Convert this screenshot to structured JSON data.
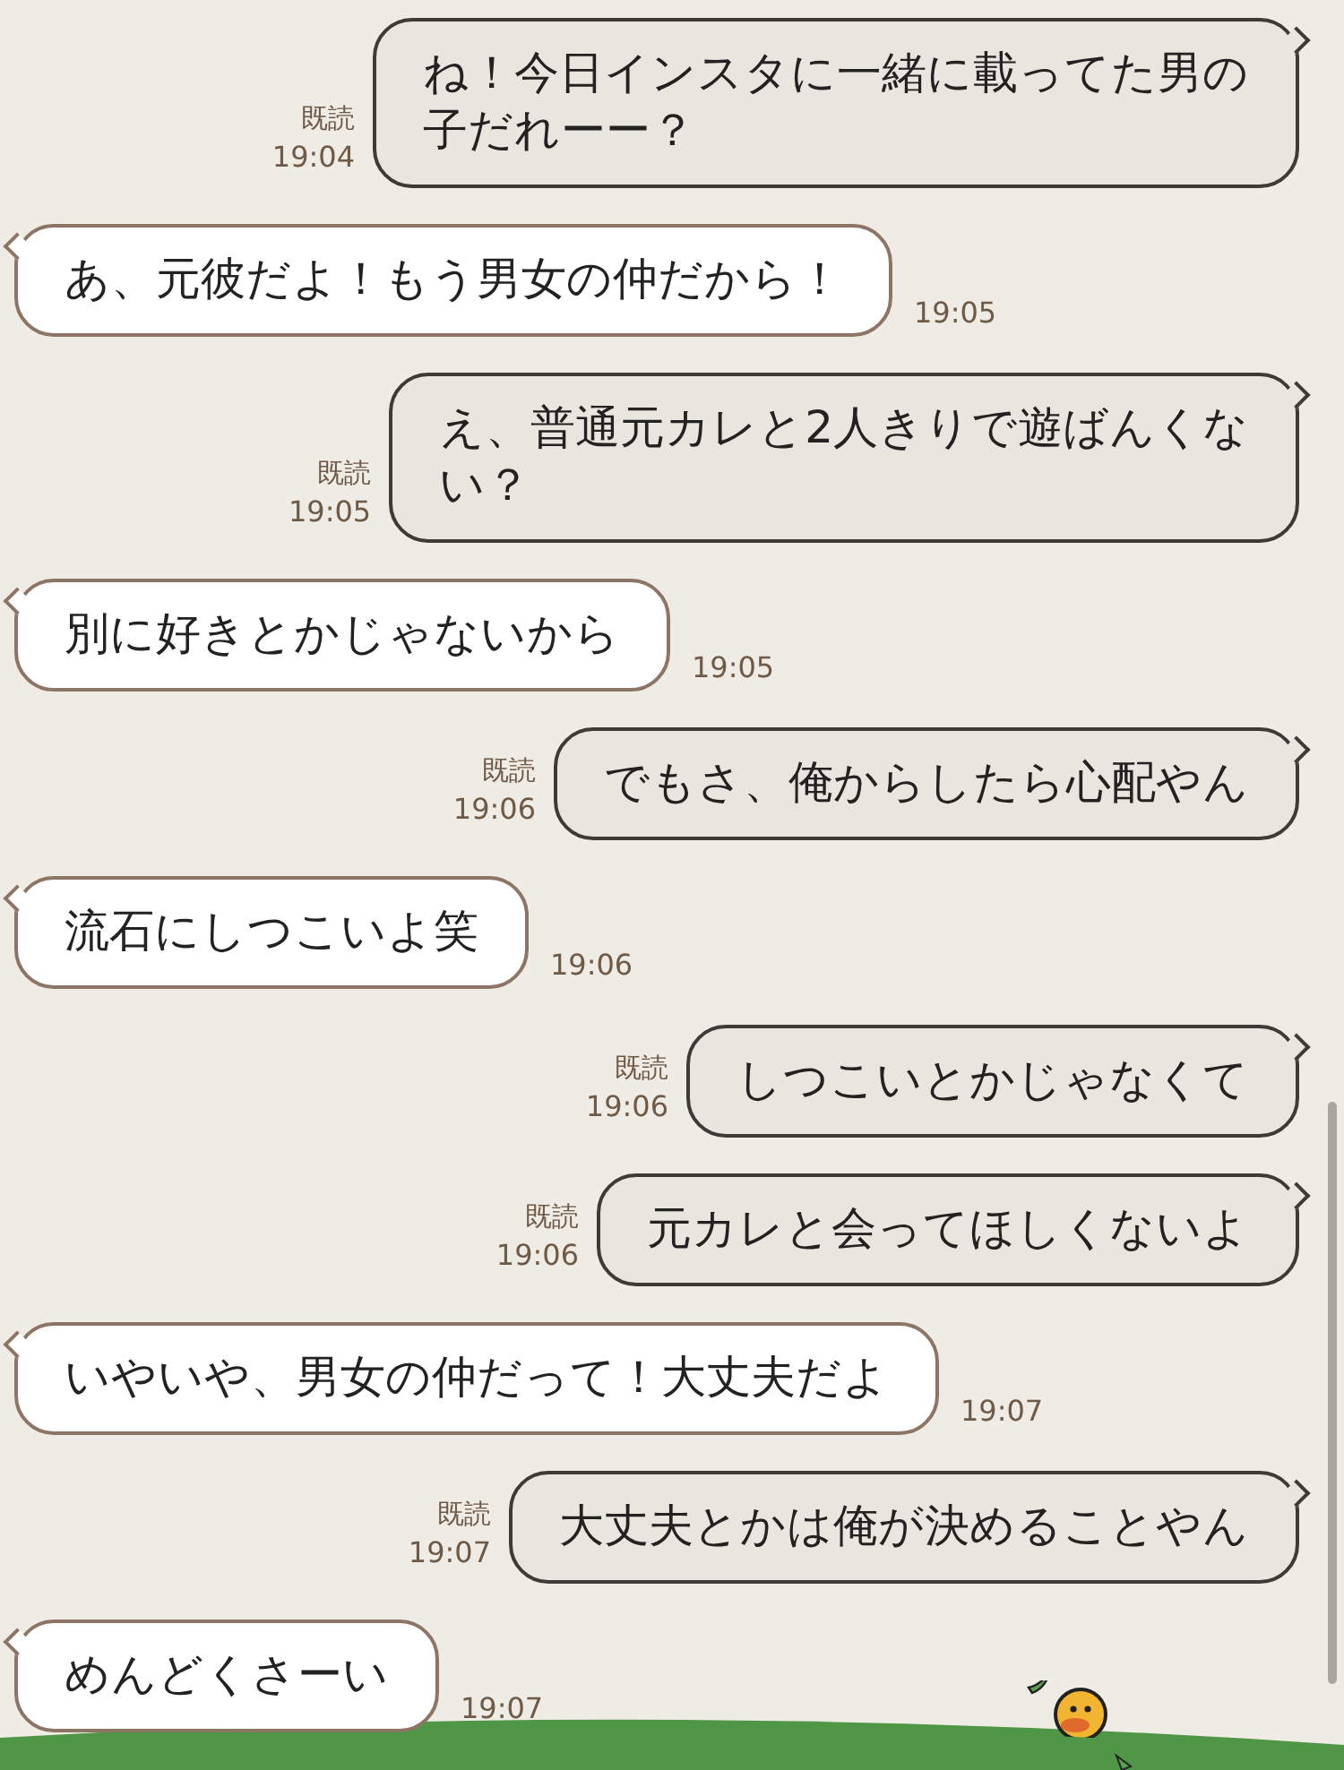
{
  "messages": [
    {
      "kind": "sent",
      "read": true,
      "read_label": "既読",
      "time": "19:04",
      "lines": [
        "ね！今日インスタに一緒に載ってた男の",
        "子だれーー？"
      ]
    },
    {
      "kind": "received",
      "time": "19:05",
      "lines": [
        "あ、元彼だよ！もう男女の仲だから！"
      ]
    },
    {
      "kind": "sent",
      "read": true,
      "read_label": "既読",
      "time": "19:05",
      "lines": [
        "え、普通元カレと2人きりで遊ばんくな",
        "い？"
      ]
    },
    {
      "kind": "received",
      "time": "19:05",
      "lines": [
        "別に好きとかじゃないから"
      ]
    },
    {
      "kind": "sent",
      "read": true,
      "read_label": "既読",
      "time": "19:06",
      "lines": [
        "でもさ、俺からしたら心配やん"
      ]
    },
    {
      "kind": "received",
      "time": "19:06",
      "lines": [
        "流石にしつこいよ笑"
      ]
    },
    {
      "kind": "sent",
      "read": true,
      "read_label": "既読",
      "time": "19:06",
      "lines": [
        "しつこいとかじゃなくて"
      ]
    },
    {
      "kind": "sent",
      "read": true,
      "read_label": "既読",
      "time": "19:06",
      "lines": [
        "元カレと会ってほしくないよ"
      ]
    },
    {
      "kind": "received",
      "time": "19:07",
      "lines": [
        "いやいや、男女の仲だって！大丈夫だよ"
      ]
    },
    {
      "kind": "sent",
      "read": true,
      "read_label": "既読",
      "time": "19:07",
      "lines": [
        "大丈夫とかは俺が決めることやん"
      ]
    },
    {
      "kind": "received",
      "time": "19:07",
      "lines": [
        "めんどくさーい"
      ]
    }
  ]
}
